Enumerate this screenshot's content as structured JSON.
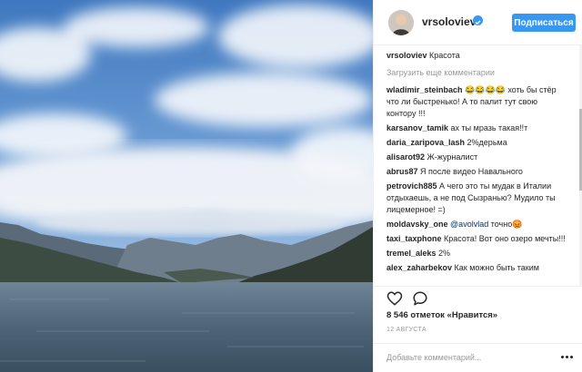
{
  "post": {
    "author": "vrsoloviev",
    "follow_label": "Подписаться",
    "caption_user": "vrsoloviev",
    "caption_text": "Красота",
    "load_more": "Загрузить еще комментарии",
    "comments": [
      {
        "user": "wladimir_steinbach",
        "text": " 😂😂😂😂 хоть бы стёр что ли быстренько! А то палит тут свою контору !!!"
      },
      {
        "user": "karsanov_tamik",
        "text": " ах ты мразь такая!!т"
      },
      {
        "user": "daria_zaripova_lash",
        "text": " 2%дерьма"
      },
      {
        "user": "alisarot92",
        "text": " Ж-журналист"
      },
      {
        "user": "abrus87",
        "text": " Я после видео Навального"
      },
      {
        "user": "petrovich885",
        "text": " А чего это ты мудак в Италии отдыхаешь, а не под Сызранью? Мудило ты лицемерное! =)"
      },
      {
        "user": "moldavsky_one",
        "mention": "@avolvlad",
        "text": " точно😡"
      },
      {
        "user": "taxi_taxphone",
        "text": " Красота! Вот оно озеро мечты!!!"
      },
      {
        "user": "tremel_aleks",
        "text": " 2%"
      },
      {
        "user": "alex_zaharbekov",
        "text": " Как можно быть таким"
      }
    ],
    "likes_count": "8 546 отметок",
    "likes_suffix": " «Нравится»",
    "date": "12 АВГУСТА",
    "comment_placeholder": "Добавьте комментарий...",
    "icons": [
      "heart-icon",
      "comment-icon",
      "more-options-icon",
      "verified-badge-icon"
    ],
    "colors": {
      "accent": "#3897f0",
      "text": "#262626",
      "muted": "#999999"
    }
  }
}
